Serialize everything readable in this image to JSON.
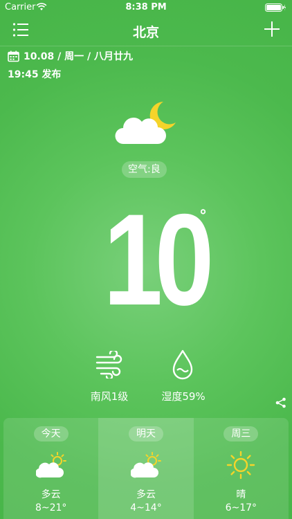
{
  "status": {
    "carrier": "Carrier",
    "time": "8:38 PM"
  },
  "nav": {
    "city": "北京"
  },
  "date_info": {
    "date": "10.08 / 周一 / 八月廿九",
    "publish": "19:45 发布"
  },
  "current": {
    "air": "空气:良",
    "temp": "10",
    "degree": "°",
    "wind": "南风1级",
    "humidity": "湿度59%",
    "icon": "partly-cloudy-night-icon"
  },
  "forecast": [
    {
      "day": "今天",
      "condition": "多云",
      "range": "8~21°",
      "icon": "partly-cloudy-icon"
    },
    {
      "day": "明天",
      "condition": "多云",
      "range": "4~14°",
      "icon": "partly-cloudy-icon"
    },
    {
      "day": "周三",
      "condition": "晴",
      "range": "6~17°",
      "icon": "sunny-icon"
    }
  ],
  "colors": {
    "background": "#4cb94d",
    "moon": "#f5d42a",
    "sun": "#f5d42a"
  }
}
